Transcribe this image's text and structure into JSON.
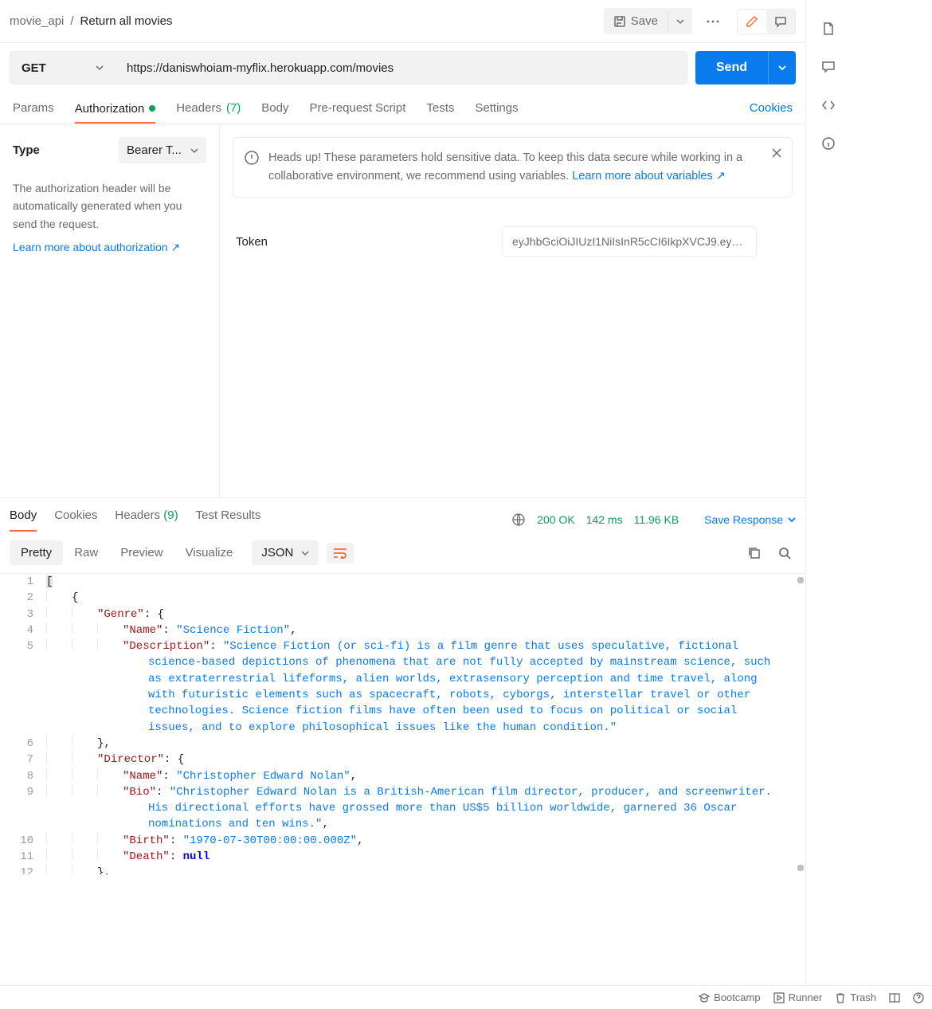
{
  "breadcrumb": {
    "collection": "movie_api",
    "request": "Return all movies"
  },
  "header": {
    "save": "Save"
  },
  "request": {
    "method": "GET",
    "url": "https://daniswhoiam-myflix.herokuapp.com/movies",
    "send": "Send"
  },
  "tabs": {
    "params": "Params",
    "auth": "Authorization",
    "headers": "Headers",
    "headers_count": "(7)",
    "body": "Body",
    "prereq": "Pre-request Script",
    "tests": "Tests",
    "settings": "Settings",
    "cookies": "Cookies"
  },
  "auth": {
    "type_label": "Type",
    "type_value": "Bearer T...",
    "description": "The authorization header will be automatically generated when you send the request.",
    "learn": "Learn more about authorization",
    "banner": "Heads up! These parameters hold sensitive data. To keep this data secure while working in a collaborative environment, we recommend using variables.",
    "banner_link": "Learn more about variables",
    "token_label": "Token",
    "token_value": "eyJhbGciOiJIUzI1NiIsInR5cCI6IkpXVCJ9.eyJ..."
  },
  "response": {
    "tabs": {
      "body": "Body",
      "cookies": "Cookies",
      "headers": "Headers",
      "headers_count": "(9)",
      "tests": "Test Results"
    },
    "status": "200 OK",
    "time": "142 ms",
    "size": "11.96 KB",
    "save": "Save Response",
    "view": {
      "pretty": "Pretty",
      "raw": "Raw",
      "preview": "Preview",
      "visualize": "Visualize",
      "format": "JSON"
    },
    "json_body": [
      {
        "Genre": {
          "Name": "Science Fiction",
          "Description": "Science Fiction (or sci-fi) is a film genre that uses speculative, fictional science-based depictions of phenomena that are not fully accepted by mainstream science, such as extraterrestrial lifeforms, alien worlds, extrasensory perception and time travel, along with futuristic elements such as spacecraft, robots, cyborgs, interstellar travel or other technologies. Science fiction films have often been used to focus on political or social issues, and to explore philosophical issues like the human condition."
        },
        "Director": {
          "Name": "Christopher Edward Nolan",
          "Bio": "Christopher Edward Nolan is a British-American film director, producer, and screenwriter. His directional efforts have grossed more than US$5 billion worldwide, garnered 36 Oscar nominations and ten wins.",
          "Birth": "1970-07-30T00:00:00.000Z",
          "Death": null
        },
        "Actors": []
      }
    ]
  },
  "footer": {
    "bootcamp": "Bootcamp",
    "runner": "Runner",
    "trash": "Trash"
  }
}
